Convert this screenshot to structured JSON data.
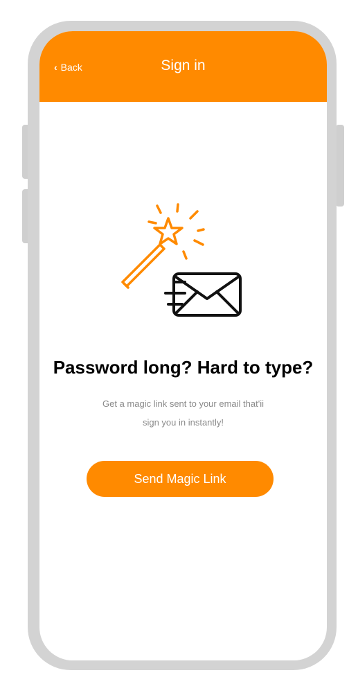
{
  "colors": {
    "accent": "#ff8a00",
    "frame": "#d3d3d3",
    "headline": "#000000",
    "subtext": "#8a8a8a",
    "illustration_stroke": "#111111"
  },
  "header": {
    "back_label": "Back",
    "back_icon": "chevron-left-icon",
    "title": "Sign in"
  },
  "main": {
    "illustration_icons": [
      "magic-wand-icon",
      "envelope-icon"
    ],
    "headline": "Password long? Hard to type?",
    "subtext_line1": "Get a magic link sent to your email that'ii",
    "subtext_line2": "sign you in instantly!",
    "button_label": "Send Magic Link"
  }
}
